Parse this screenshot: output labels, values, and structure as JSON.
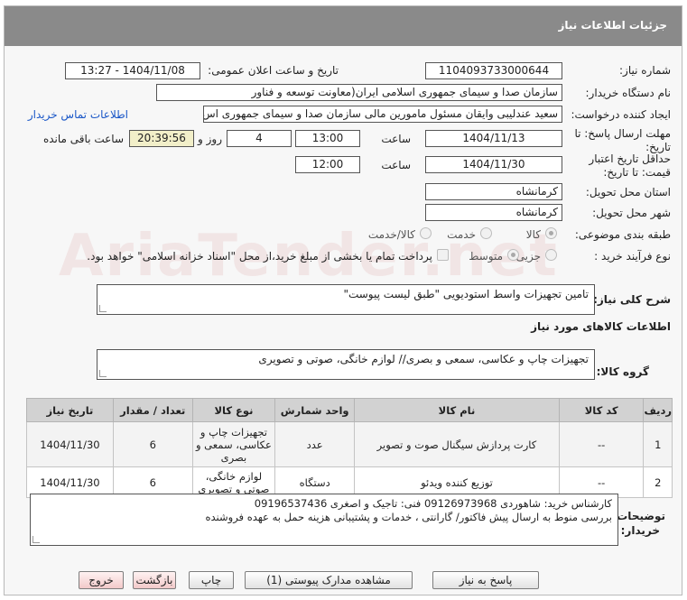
{
  "header": {
    "title": "جزئیات اطلاعات نیاز"
  },
  "fields": {
    "need_number_label": "شماره نیاز:",
    "need_number": "1104093733000644",
    "announce_label": "تاریخ و ساعت اعلان عمومی:",
    "announce_value": "1404/11/08 - 13:27",
    "buyer_org_label": "نام دستگاه خریدار:",
    "buyer_org": "سازمان صدا و سیمای جمهوری اسلامی ایران(معاونت توسعه و فناور",
    "creator_label": "ایجاد کننده درخواست:",
    "creator": "سعید عندلیبی وایقان مسئول مامورین مالی  سازمان صدا و سیمای جمهوری اس",
    "contact_link": "اطلاعات تماس خریدار",
    "deadline_label_1": "مهلت ارسال پاسخ: تا",
    "deadline_label_2": "تاریخ:",
    "deadline_date": "1404/11/13",
    "time_label": "ساعت",
    "deadline_time": "13:00",
    "days_value": "4",
    "days_label": "روز و",
    "remaining_time": "20:39:56",
    "remaining_label": "ساعت باقی مانده",
    "validity_label_1": "حداقل تاریخ اعتبار",
    "validity_label_2": "قیمت: تا تاریخ:",
    "validity_date": "1404/11/30",
    "validity_time": "12:00",
    "province_label": "استان محل تحویل:",
    "province": "کرمانشاه",
    "city_label": "شهر محل تحویل:",
    "city": "کرمانشاه",
    "category_label": "طبقه بندی موضوعی:",
    "category_options": [
      "کالا",
      "خدمت",
      "کالا/خدمت"
    ],
    "process_label": "نوع فرآیند خرید :",
    "process_options": [
      "جزیی",
      "متوسط"
    ],
    "payment_note": "پرداخت تمام یا بخشی از مبلغ خرید،از محل \"اسناد خزانه اسلامی\" خواهد بود."
  },
  "description": {
    "label": "شرح کلی نیاز:",
    "value": "تامین تجهیزات واسط استودیویی \"طبق لیست پیوست\""
  },
  "goods_section": {
    "title": "اطلاعات کالاهای مورد نیاز",
    "group_label": "گروه کالا:",
    "group_value": "تجهیزات چاپ و عکاسی، سمعی و بصری// لوازم خانگی، صوتی و تصویری"
  },
  "table": {
    "headers": [
      "ردیف",
      "کد کالا",
      "نام کالا",
      "واحد شمارش",
      "نوع کالا",
      "تعداد / مقدار",
      "تاریخ نیاز"
    ],
    "rows": [
      [
        "1",
        "--",
        "کارت پردازش سیگنال صوت و تصویر",
        "عدد",
        "تجهیزات چاپ و عکاسی، سمعی و بصری",
        "6",
        "1404/11/30"
      ],
      [
        "2",
        "--",
        "توزیع کننده ویدئو",
        "دستگاه",
        "لوازم خانگی، صوتی و تصویری",
        "6",
        "1404/11/30"
      ]
    ]
  },
  "buyer_notes": {
    "label_1": "توضیحات",
    "label_2": "خریدار:",
    "line_1": "کارشناس خرید: شاهوردی 09126973968  فنی: تاجیک و اصغری 09196537436",
    "line_2": "بررسی منوط به ارسال پیش فاکتور/ گارانتی ، خدمات و پشتیبانی هزینه حمل به عهده فروشنده"
  },
  "buttons": {
    "reply": "پاسخ به نیاز",
    "view_docs": "مشاهده مدارک پیوستی (1)",
    "print": "چاپ",
    "back": "بازگشت",
    "exit": "خروج"
  },
  "watermark": "AriaTender.net"
}
